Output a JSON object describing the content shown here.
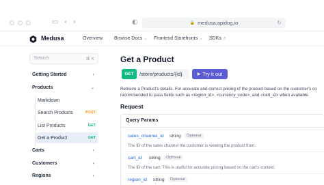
{
  "browser": {
    "url": "medusa.apidog.io"
  },
  "nav": {
    "brand": "Medusa",
    "items": [
      "Overview",
      "Browse Docs",
      "Frontend Storefronts",
      "SDKs"
    ]
  },
  "sidebar": {
    "search_placeholder": "Search",
    "search_shortcut": "⌘ K",
    "sections": [
      {
        "label": "Getting Started"
      },
      {
        "label": "Products"
      },
      {
        "label": "Carts"
      },
      {
        "label": "Customers"
      },
      {
        "label": "Regions"
      }
    ],
    "items": [
      {
        "label": "Markdown",
        "method": ""
      },
      {
        "label": "Search Products",
        "method": "POST"
      },
      {
        "label": "List Products",
        "method": "GET"
      },
      {
        "label": "Get a Product",
        "method": "GET"
      }
    ]
  },
  "page": {
    "title": "Get a Product",
    "method": "GET",
    "path": "/store/products/{id}",
    "try_label": "Try it out",
    "description_lines": [
      "Retrieve a Product's details. For accurate and correct pricing of the product based on the customer's co",
      "recommended to pass fields such as <region_id>, <currency_code>, and <cart_id> when available."
    ],
    "request_heading": "Request",
    "params_heading": "Query Params",
    "params": [
      {
        "name": "sales_channel_id",
        "type": "string",
        "optional": "Optional",
        "desc": "The ID of the sales channel the customer is viewing the product from."
      },
      {
        "name": "cart_id",
        "type": "string",
        "optional": "Optional",
        "desc": "The ID of the cart. This is useful for accurate pricing based on the cart's context."
      },
      {
        "name": "region_id",
        "type": "string",
        "optional": "Optional",
        "desc": ""
      }
    ]
  },
  "colors": {
    "get": "#10b981",
    "post": "#f59e0b",
    "accent": "#5b5bd6",
    "param_name": "#2563eb"
  }
}
